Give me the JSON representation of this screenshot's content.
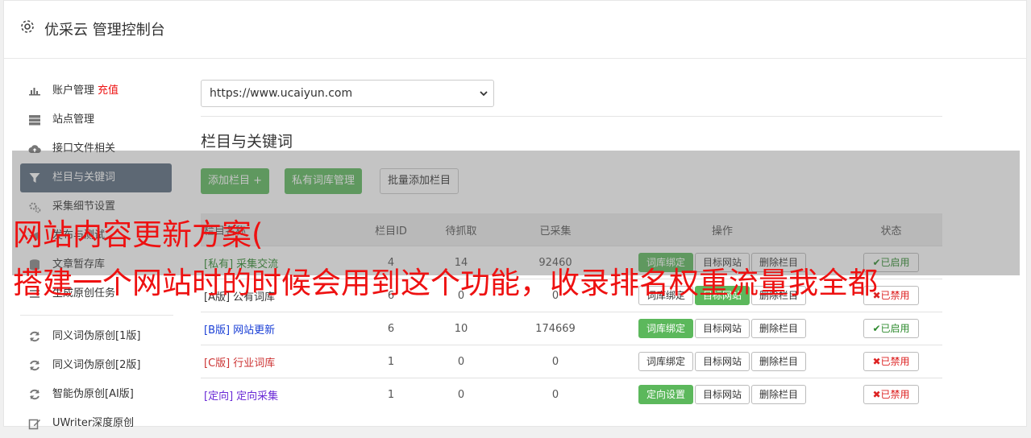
{
  "header": {
    "title": "优采云 管理控制台",
    "icon": "gear-icon"
  },
  "sidebar": {
    "items": [
      {
        "label": "账户管理",
        "accent": "充值",
        "icon": "bar-chart-icon"
      },
      {
        "label": "站点管理",
        "icon": "server-icon"
      },
      {
        "label": "接口文件相关",
        "icon": "cloud-upload-icon"
      },
      {
        "label": "栏目与关键词",
        "icon": "filter-icon",
        "active": true
      },
      {
        "label": "采集细节设置",
        "icon": "gears-icon"
      },
      {
        "label": "发布与测试",
        "icon": "send-icon"
      },
      {
        "label": "文章暂存库",
        "icon": "database-icon"
      },
      {
        "label": "生成原创任务",
        "icon": "list-icon"
      },
      {
        "label": "同义词伪原创[1版]",
        "icon": "refresh-icon"
      },
      {
        "label": "同义词伪原创[2版]",
        "icon": "refresh-icon"
      },
      {
        "label": "智能伪原创[AI版]",
        "icon": "refresh-icon"
      },
      {
        "label": "UWriter深度原创",
        "icon": "edit-icon"
      }
    ]
  },
  "site_select": {
    "value": "https://www.ucaiyun.com"
  },
  "section": {
    "title": "栏目与关键词"
  },
  "toolbar": {
    "add_column": "添加栏目 +",
    "private_lib": "私有词库管理",
    "batch_add": "批量添加栏目"
  },
  "table": {
    "headers": [
      "栏目名称",
      "栏目ID",
      "待抓取",
      "已采集",
      "操作",
      "状态"
    ],
    "rows": [
      {
        "tag": "[私有]",
        "name": "采集交流",
        "id": "4",
        "pending": "14",
        "collected": "92460",
        "btn1": "词库绑定",
        "btn2": "目标网站",
        "btn3": "删除栏目",
        "status": "已启用"
      },
      {
        "tag": "[A版]",
        "name": "公有词库",
        "id": "6",
        "pending": "0",
        "collected": "0",
        "btn1": "词库绑定",
        "btn2": "目标网站",
        "btn3": "删除栏目",
        "status": "已禁用"
      },
      {
        "tag": "[B版]",
        "name": "网站更新",
        "id": "6",
        "pending": "10",
        "collected": "174669",
        "btn1": "词库绑定",
        "btn2": "目标网站",
        "btn3": "删除栏目",
        "status": "已启用"
      },
      {
        "tag": "[C版]",
        "name": "行业词库",
        "id": "1",
        "pending": "0",
        "collected": "0",
        "btn1": "词库绑定",
        "btn2": "目标网站",
        "btn3": "删除栏目",
        "status": "已禁用"
      },
      {
        "tag": "[定向]",
        "name": "定向采集",
        "id": "1",
        "pending": "0",
        "collected": "0",
        "btn1": "定向设置",
        "btn2": "目标网站",
        "btn3": "删除栏目",
        "status": "已禁用"
      }
    ]
  },
  "overlay_text": {
    "line1": "网站内容更新方案(",
    "line2": "搭建一个网站时的时候会用到这个功能，收录排名权重流量我全都"
  },
  "colors": {
    "accent_green": "#5cb85c",
    "active_sidebar": "#5a6b7e",
    "overlay_red": "#ee1111"
  }
}
